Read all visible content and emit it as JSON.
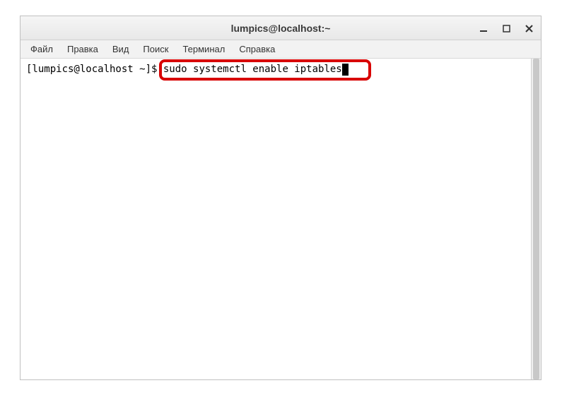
{
  "titlebar": {
    "title": "lumpics@localhost:~"
  },
  "window_controls": {
    "minimize": "—",
    "maximize": "◻",
    "close": "✕"
  },
  "menubar": {
    "items": [
      "Файл",
      "Правка",
      "Вид",
      "Поиск",
      "Терминал",
      "Справка"
    ]
  },
  "terminal": {
    "prompt": "[lumpics@localhost ~]$ ",
    "command": "sudo systemctl enable iptables"
  },
  "annotation": {
    "highlight_color": "#d80000"
  }
}
